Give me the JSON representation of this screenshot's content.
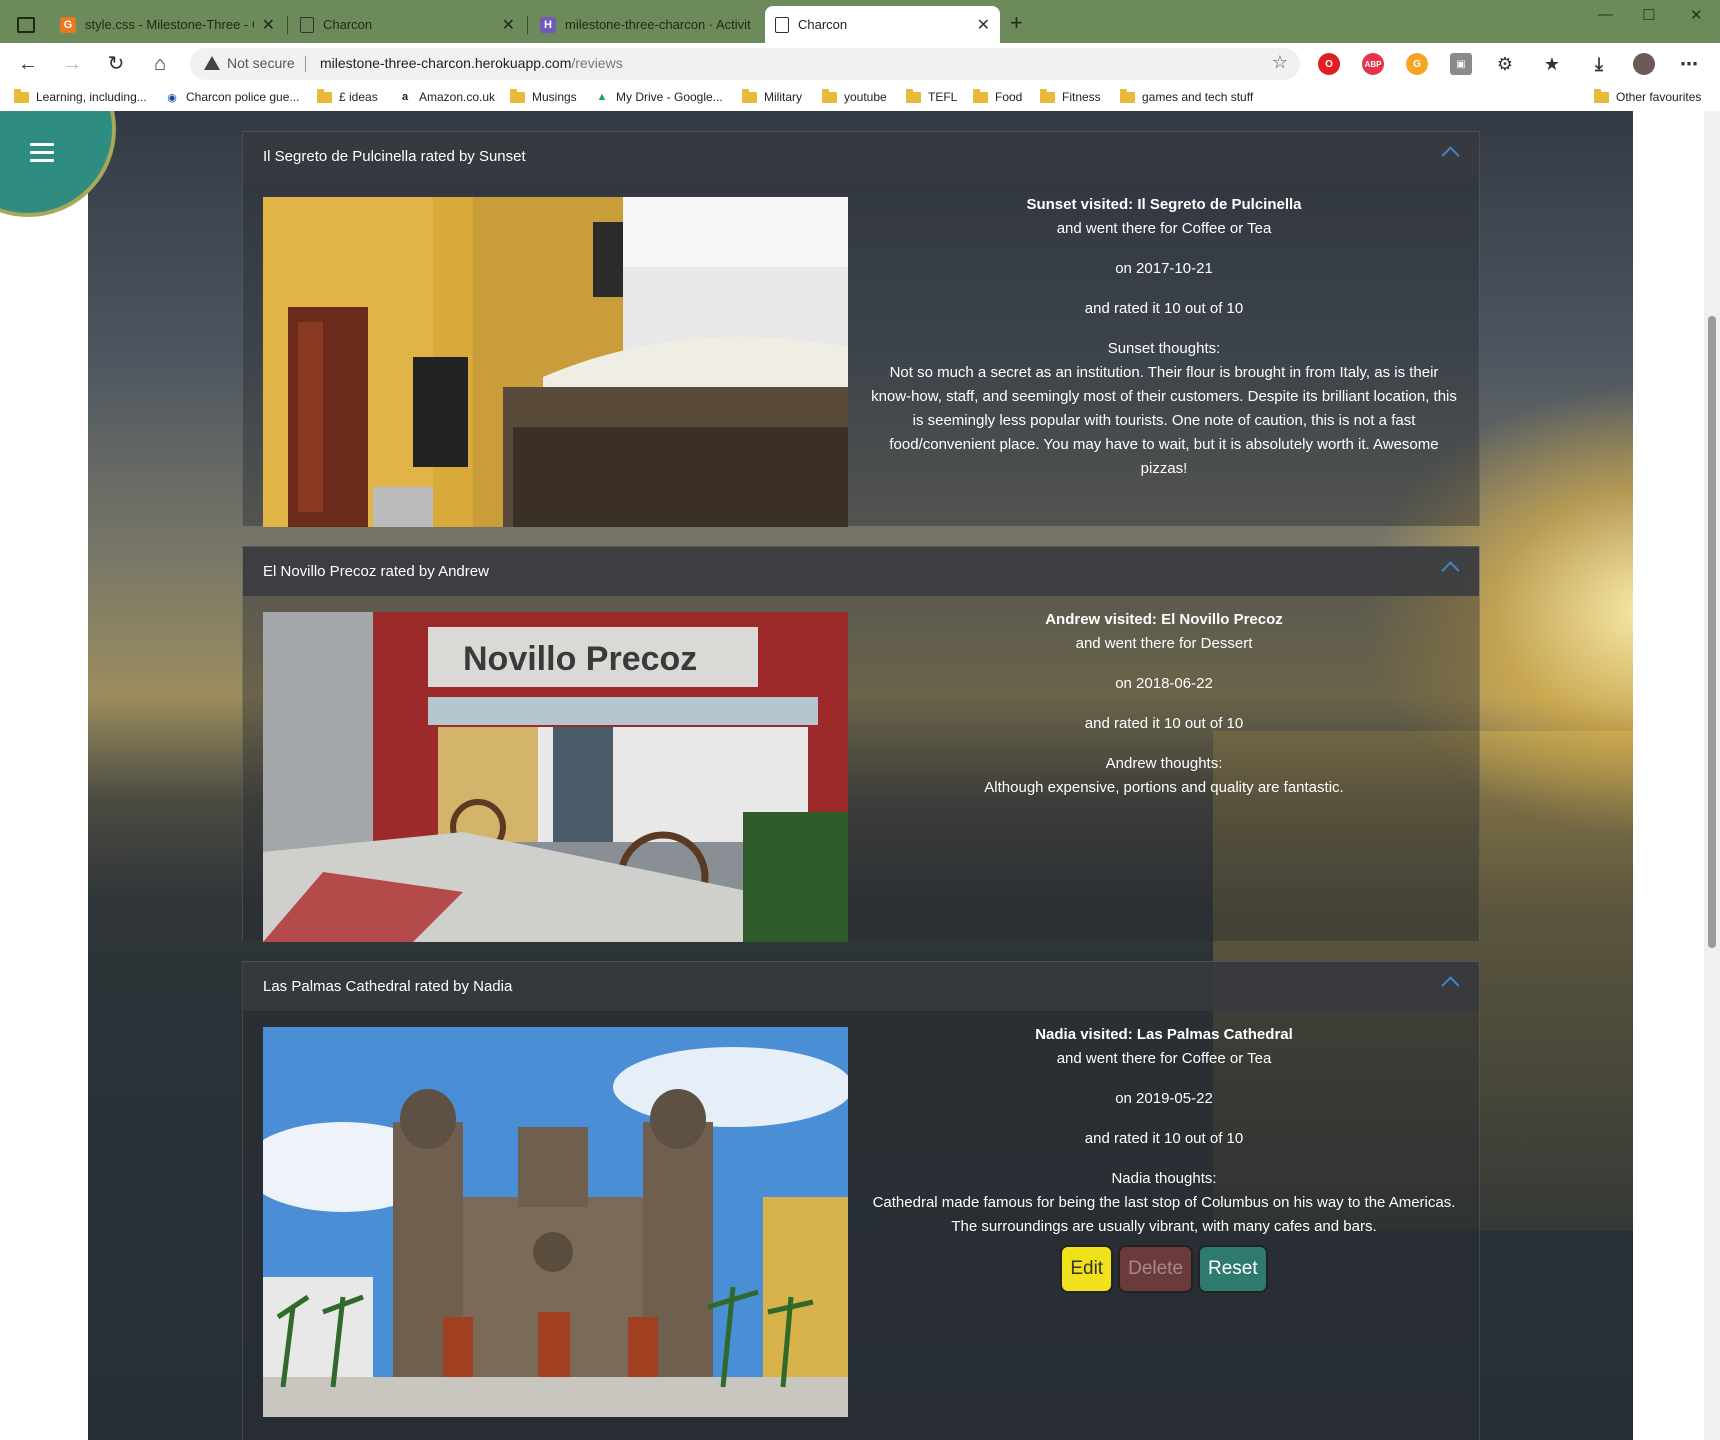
{
  "browser": {
    "tabs": [
      {
        "title": "style.css - Milestone-Three - Gitp",
        "favicon": "gitpod-icon",
        "color": "#e8791e"
      },
      {
        "title": "Charcon",
        "favicon": "page-icon",
        "color": "#444444"
      },
      {
        "title": "milestone-three-charcon · Activit",
        "favicon": "heroku-icon",
        "color": "#6f5bb7"
      },
      {
        "title": "Charcon",
        "favicon": "page-icon",
        "color": "#444444",
        "active": true
      }
    ],
    "security_label": "Not secure",
    "url_host": "milestone-three-charcon.herokuapp.com",
    "url_path": "/reviews",
    "bookmarks": [
      {
        "label": "Learning, including...",
        "icon": "folder-icon"
      },
      {
        "label": "Charcon police gue...",
        "icon": "globe-icon"
      },
      {
        "label": "£ ideas",
        "icon": "folder-icon"
      },
      {
        "label": "Amazon.co.uk",
        "icon": "amazon-icon"
      },
      {
        "label": "Musings",
        "icon": "folder-icon"
      },
      {
        "label": "My Drive - Google...",
        "icon": "drive-icon"
      },
      {
        "label": "Military",
        "icon": "folder-icon"
      },
      {
        "label": "youtube",
        "icon": "folder-icon"
      },
      {
        "label": "TEFL",
        "icon": "folder-icon"
      },
      {
        "label": "Food",
        "icon": "folder-icon"
      },
      {
        "label": "Fitness",
        "icon": "folder-icon"
      },
      {
        "label": "games and tech stuff",
        "icon": "folder-icon"
      }
    ],
    "other_favourites": "Other favourites"
  },
  "reviews": [
    {
      "header": "Il Segreto de Pulcinella rated by Sunset",
      "visited": "Sunset visited: Il Segreto de Pulcinella",
      "purpose": "and went there for Coffee or Tea",
      "date": "on 2017-10-21",
      "rating": "and rated it 10 out of 10",
      "thoughts_label": "Sunset thoughts:",
      "thoughts": "Not so much a secret as an institution. Their flour is brought in from Italy, as is their know-how, staff, and seemingly most of their customers. Despite its brilliant location, this is seemingly less popular with tourists. One note of caution, this is not a fast food/convenient place. You may have to wait, but it is absolutely worth it. Awesome pizzas!"
    },
    {
      "header": "El Novillo Precoz rated by Andrew",
      "visited": "Andrew visited: El Novillo Precoz",
      "purpose": "and went there for Dessert",
      "date": "on 2018-06-22",
      "rating": "and rated it 10 out of 10",
      "thoughts_label": "Andrew thoughts:",
      "thoughts": "Although expensive, portions and quality are fantastic.",
      "photo_sign": "Novillo Precoz"
    },
    {
      "header": "Las Palmas Cathedral rated by Nadia",
      "visited": "Nadia visited: Las Palmas Cathedral",
      "purpose": "and went there for Coffee or Tea",
      "date": "on 2019-05-22",
      "rating": "and rated it 10 out of 10",
      "thoughts_label": "Nadia thoughts:",
      "thoughts": "Cathedral made famous for being the last stop of Columbus on his way to the Americas. The surroundings are usually vibrant, with many cafes and bars.",
      "actions": {
        "edit": "Edit",
        "delete": "Delete",
        "reset": "Reset"
      }
    }
  ]
}
